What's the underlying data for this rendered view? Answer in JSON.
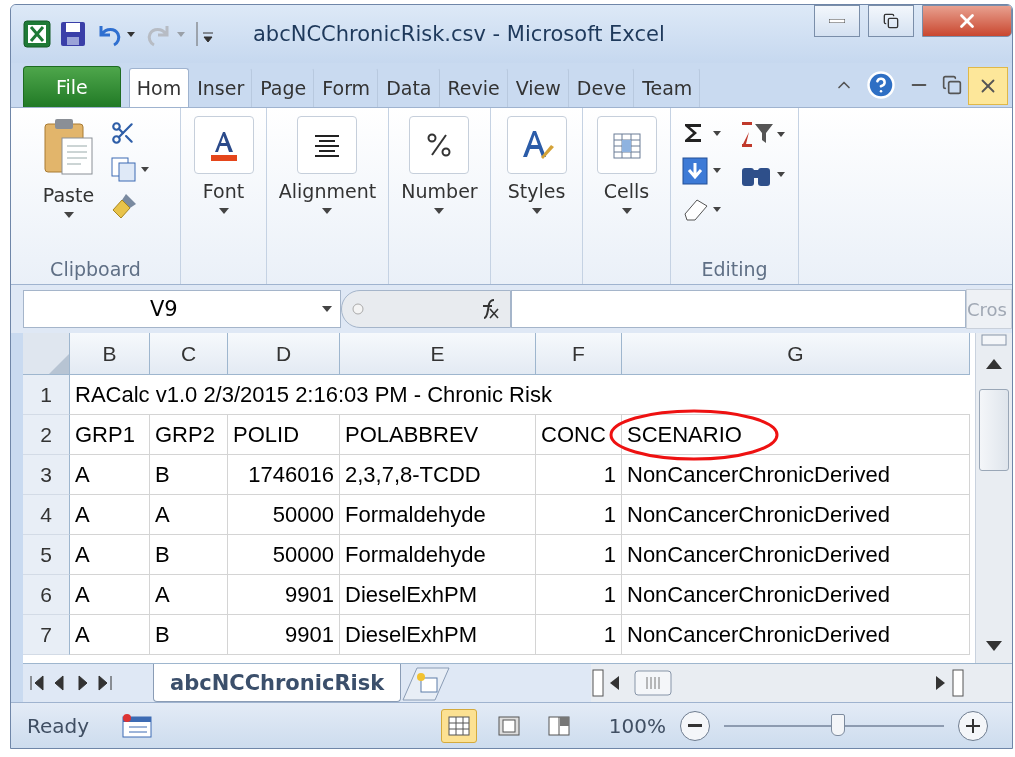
{
  "window": {
    "title": "abcNCChronicRisk.csv  -  Microsoft Excel"
  },
  "ribbon_tabs": [
    {
      "label": "File",
      "kind": "file",
      "selected": false
    },
    {
      "label": "Hom",
      "kind": "tab",
      "selected": true
    },
    {
      "label": "Inser",
      "kind": "tab",
      "selected": false
    },
    {
      "label": "Page",
      "kind": "tab",
      "selected": false
    },
    {
      "label": "Form",
      "kind": "tab",
      "selected": false
    },
    {
      "label": "Data",
      "kind": "tab",
      "selected": false
    },
    {
      "label": "Revie",
      "kind": "tab",
      "selected": false
    },
    {
      "label": "View",
      "kind": "tab",
      "selected": false
    },
    {
      "label": "Deve",
      "kind": "tab",
      "selected": false
    },
    {
      "label": "Team",
      "kind": "tab",
      "selected": false
    }
  ],
  "clipboard": {
    "paste": "Paste",
    "label": "Clipboard"
  },
  "collapsed_groups": [
    {
      "label": "Font",
      "kind": "font"
    },
    {
      "label": "Alignment",
      "kind": "alignment"
    },
    {
      "label": "Number",
      "kind": "number"
    },
    {
      "label": "Styles",
      "kind": "styles"
    },
    {
      "label": "Cells",
      "kind": "cells"
    }
  ],
  "editing": {
    "label": "Editing"
  },
  "formula_bar": {
    "name_box": "V9",
    "overflow": "Cros"
  },
  "grid": {
    "columns": [
      {
        "label": "B"
      },
      {
        "label": "C"
      },
      {
        "label": "D"
      },
      {
        "label": "E"
      },
      {
        "label": "F"
      },
      {
        "label": "G"
      }
    ],
    "rows": [
      {
        "number": "1",
        "spanning_text": "RACalc v1.0 2/3/2015 2:16:03 PM - Chronic Risk"
      },
      {
        "number": "2",
        "cells": [
          "GRP1",
          "GRP2",
          "POLID",
          "POLABBREV",
          "CONC",
          "SCENARIO"
        ],
        "last_cell_circled": true
      },
      {
        "number": "3",
        "cells": [
          "A",
          "B",
          "1746016",
          "2,3,7,8-TCDD",
          "1",
          "NonCancerChronicDerived"
        ]
      },
      {
        "number": "4",
        "cells": [
          "A",
          "A",
          "50000",
          "Formaldehyde",
          "1",
          "NonCancerChronicDerived"
        ]
      },
      {
        "number": "5",
        "cells": [
          "A",
          "B",
          "50000",
          "Formaldehyde",
          "1",
          "NonCancerChronicDerived"
        ]
      },
      {
        "number": "6",
        "cells": [
          "A",
          "A",
          "9901",
          "DieselExhPM",
          "1",
          "NonCancerChronicDerived"
        ]
      },
      {
        "number": "7",
        "cells": [
          "A",
          "B",
          "9901",
          "DieselExhPM",
          "1",
          "NonCancerChronicDerived"
        ]
      }
    ]
  },
  "sheet_tabs": [
    {
      "label": "abcNCChronicRisk",
      "selected": true
    }
  ],
  "status_bar": {
    "status": "Ready",
    "views": [
      {
        "kind": "normal",
        "selected": true
      },
      {
        "kind": "layout",
        "selected": false
      },
      {
        "kind": "pagebreak",
        "selected": false
      }
    ],
    "zoom": "100%",
    "zoom_slider": {
      "level": 0.52
    }
  }
}
